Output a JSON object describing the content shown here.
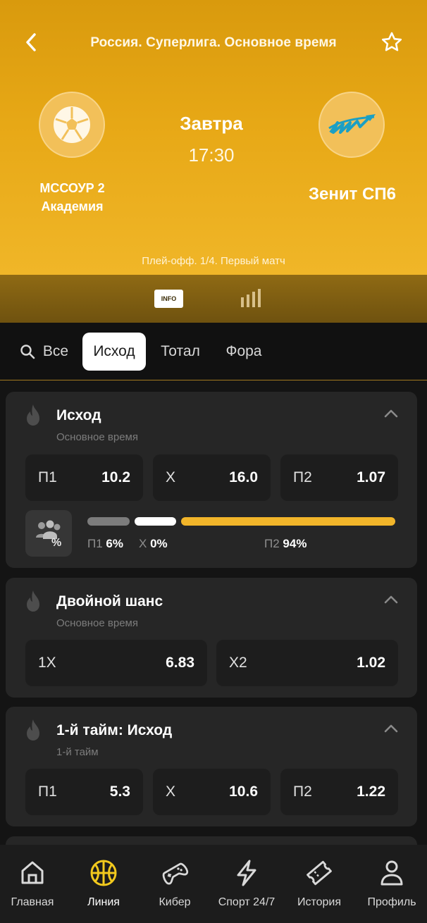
{
  "header": {
    "league": "Россия. Суперлига. Основное время",
    "home_team": "МССОУР 2\nАкадемия",
    "away_team": "Зенит СП6",
    "day": "Завтра",
    "time": "17:30",
    "stage": "Плей-офф. 1/4. Первый матч",
    "info_badge": "INFO"
  },
  "tabs": [
    {
      "label": "Все",
      "icon": "search-icon"
    },
    {
      "label": "Исход",
      "active": true
    },
    {
      "label": "Тотал"
    },
    {
      "label": "Фора"
    }
  ],
  "markets": [
    {
      "title": "Исход",
      "subtitle": "Основное время",
      "odds": [
        {
          "label": "П1",
          "value": "10.2"
        },
        {
          "label": "Х",
          "value": "16.0"
        },
        {
          "label": "П2",
          "value": "1.07"
        }
      ],
      "percentages": {
        "p1_label": "П1",
        "p1_value": "6%",
        "x_label": "Х",
        "x_value": "0%",
        "p2_label": "П2",
        "p2_value": "94%"
      }
    },
    {
      "title": "Двойной шанс",
      "subtitle": "Основное время",
      "odds": [
        {
          "label": "1Х",
          "value": "6.83"
        },
        {
          "label": "Х2",
          "value": "1.02"
        }
      ]
    },
    {
      "title": "1-й тайм: Исход",
      "subtitle": "1-й тайм",
      "odds": [
        {
          "label": "П1",
          "value": "5.3"
        },
        {
          "label": "Х",
          "value": "10.6"
        },
        {
          "label": "П2",
          "value": "1.22"
        }
      ]
    }
  ],
  "nav": [
    {
      "label": "Главная",
      "icon": "home-icon"
    },
    {
      "label": "Линия",
      "icon": "basketball-icon",
      "active": true
    },
    {
      "label": "Кибер",
      "icon": "gamepad-icon"
    },
    {
      "label": "Спорт 24/7",
      "icon": "lightning-icon"
    },
    {
      "label": "История",
      "icon": "ticket-icon"
    },
    {
      "label": "Профиль",
      "icon": "user-icon"
    }
  ],
  "colors": {
    "accent": "#f2b52a",
    "header_gradient_top": "#d99a0d",
    "background": "#141414",
    "card": "#262626"
  }
}
